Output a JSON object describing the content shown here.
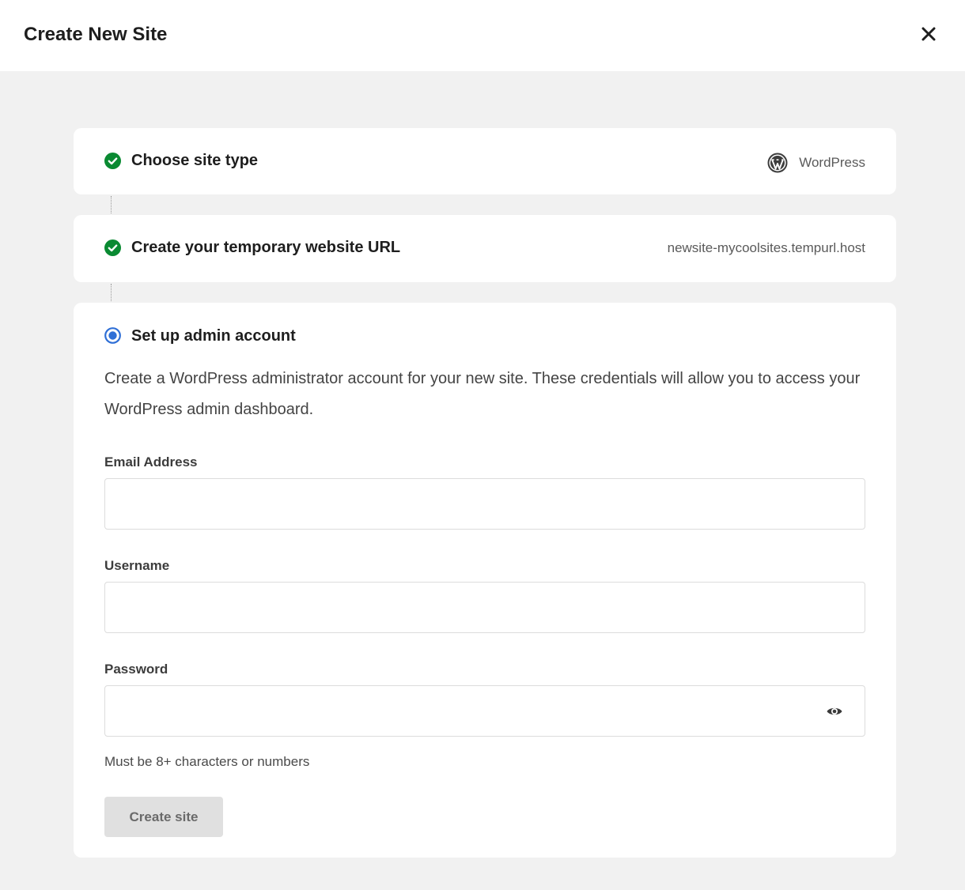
{
  "header": {
    "title": "Create New Site",
    "close_icon": "close-icon"
  },
  "steps": [
    {
      "title": "Choose site type",
      "status": "completed",
      "summary": "WordPress",
      "summary_icon": "wordpress-logo-icon"
    },
    {
      "title": "Create your temporary website URL",
      "status": "completed",
      "summary": "newsite-mycoolsites.tempurl.host"
    },
    {
      "title": "Set up admin account",
      "status": "active",
      "description": "Create a WordPress administrator account for your new site. These credentials will allow you to access your WordPress admin dashboard."
    }
  ],
  "form": {
    "email": {
      "label": "Email Address",
      "value": "",
      "placeholder": ""
    },
    "username": {
      "label": "Username",
      "value": "",
      "placeholder": ""
    },
    "password": {
      "label": "Password",
      "value": "",
      "placeholder": "",
      "toggle_icon": "eye-icon"
    },
    "password_hint": "Must be 8+ characters or numbers",
    "submit_label": "Create site",
    "submit_disabled": true
  },
  "colors": {
    "completed": "#0a8a32",
    "active": "#2f6fd6",
    "background": "#f1f1f1",
    "disabled_button": "#e0e0e0"
  }
}
